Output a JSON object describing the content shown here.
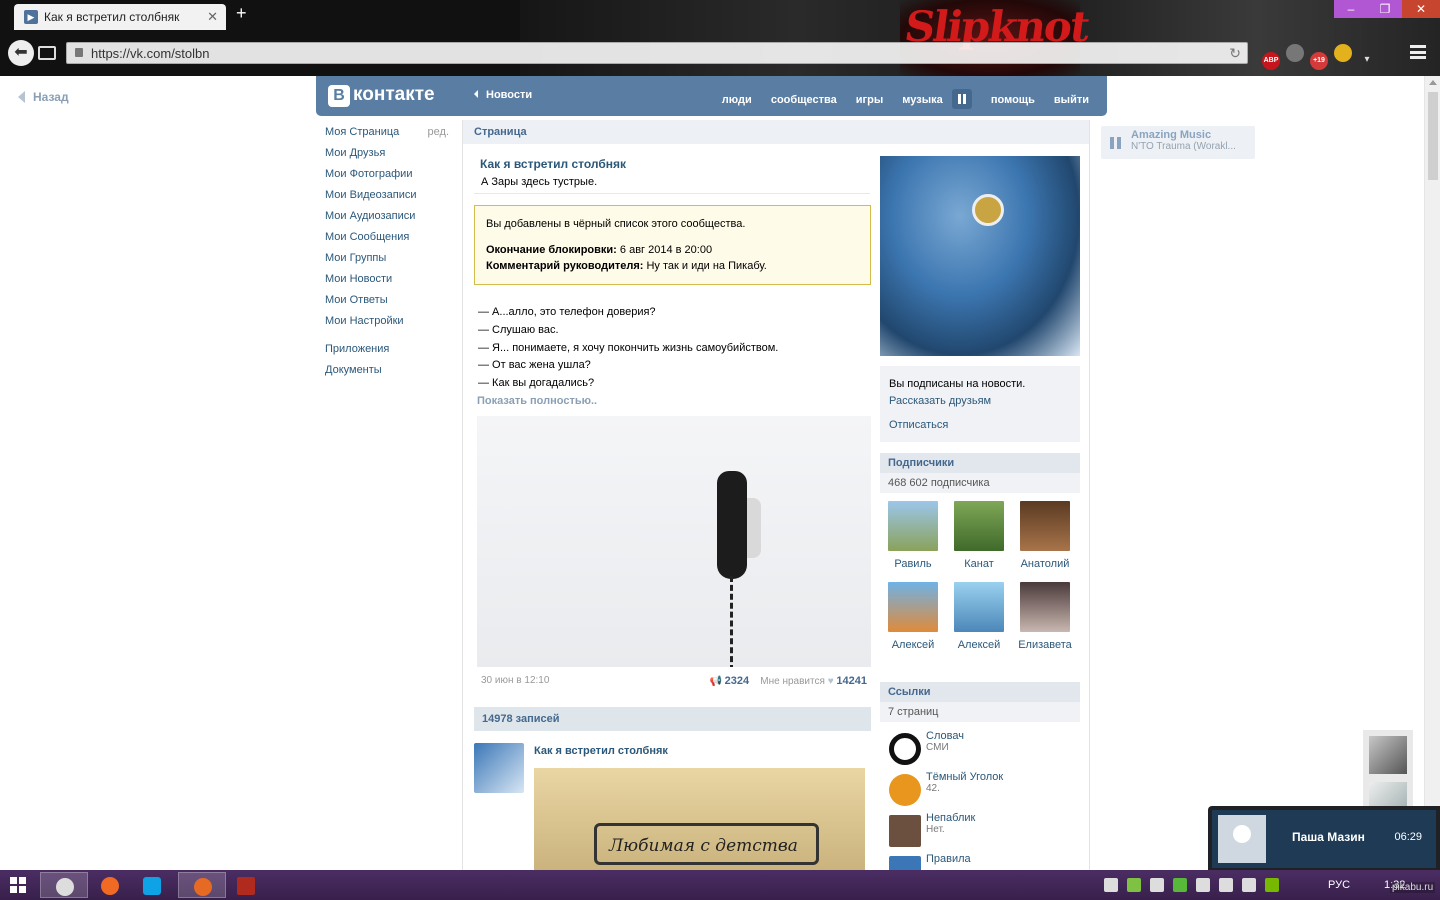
{
  "browser": {
    "tab_title": "Как я встретил столбняк",
    "new_tab": "+",
    "url": "https://vk.com/stolbn",
    "banner_text": "Slipknot",
    "ext_abp": "ABP",
    "ext_badge": "+19"
  },
  "page": {
    "back_label": "Назад",
    "header": {
      "logo": "контакте",
      "logo_letter": "В",
      "news": "Новости",
      "nav": [
        "люди",
        "сообщества",
        "игры",
        "музыка",
        "помощь",
        "выйти"
      ]
    },
    "left_menu": {
      "edit": "ред.",
      "items": [
        "Моя Страница",
        "Мои Друзья",
        "Мои Фотографии",
        "Мои Видеозаписи",
        "Мои Аудиозаписи",
        "Мои Сообщения",
        "Мои Группы",
        "Мои Новости",
        "Мои Ответы",
        "Мои Настройки"
      ],
      "extra": [
        "Приложения",
        "Документы"
      ]
    },
    "content": {
      "section_title": "Страница",
      "page_name": "Как я встретил столбняк",
      "status": "А Зары здесь тустрые.",
      "ban": {
        "line1": "Вы добавлены в чёрный список этого сообщества.",
        "end_label": "Окончание блокировки:",
        "end_value": "6 авг 2014 в 20:00",
        "comment_label": "Комментарий руководителя:",
        "comment_value": "Ну так и иди на Пикабу."
      },
      "post_lines": [
        "— А...алло, это телефон доверия?",
        "— Слушаю вас.",
        "— Я... понимаете, я хочу покончить жизнь самоубийством.",
        "— От вас жена ушла?",
        "— Как вы догадались?"
      ],
      "show_full": "Показать полностью..",
      "post_date": "30 июн в 12:10",
      "reposts": "2324",
      "like_label": "Мне нравится",
      "likes": "14241",
      "posts_count": "14978 записей",
      "wall_author": "Как я встретил столбняк",
      "wall_image_text": "Любимая с детства"
    },
    "right": {
      "subscribed": "Вы подписаны на новости.",
      "tell_friends": "Рассказать друзьям",
      "unsubscribe": "Отписаться",
      "members_title": "Подписчики",
      "members_count": "468 602 подписчика",
      "members": [
        "Равиль",
        "Канат",
        "Анатолий",
        "Алексей",
        "Алексей",
        "Елизавета"
      ],
      "links_title": "Ссылки",
      "links_count": "7 страниц",
      "links": [
        {
          "title": "Словач",
          "desc": "СМИ"
        },
        {
          "title": "Тёмный Уголок",
          "desc": "42."
        },
        {
          "title": "Непаблик",
          "desc": "Нет."
        },
        {
          "title": "Правила",
          "desc": ""
        }
      ]
    },
    "player": {
      "artist": "Amazing Music",
      "song": "N'TO Trauma (Worakl..."
    },
    "notification": {
      "name": "Паша Мазин",
      "time": "06:29"
    }
  },
  "taskbar": {
    "lang": "РУС",
    "clock": "1:32",
    "watermark": "pikabu.ru"
  },
  "colors": {
    "vk_blue": "#597da3",
    "link": "#2b587a",
    "taskbar": "#4b2d63"
  }
}
